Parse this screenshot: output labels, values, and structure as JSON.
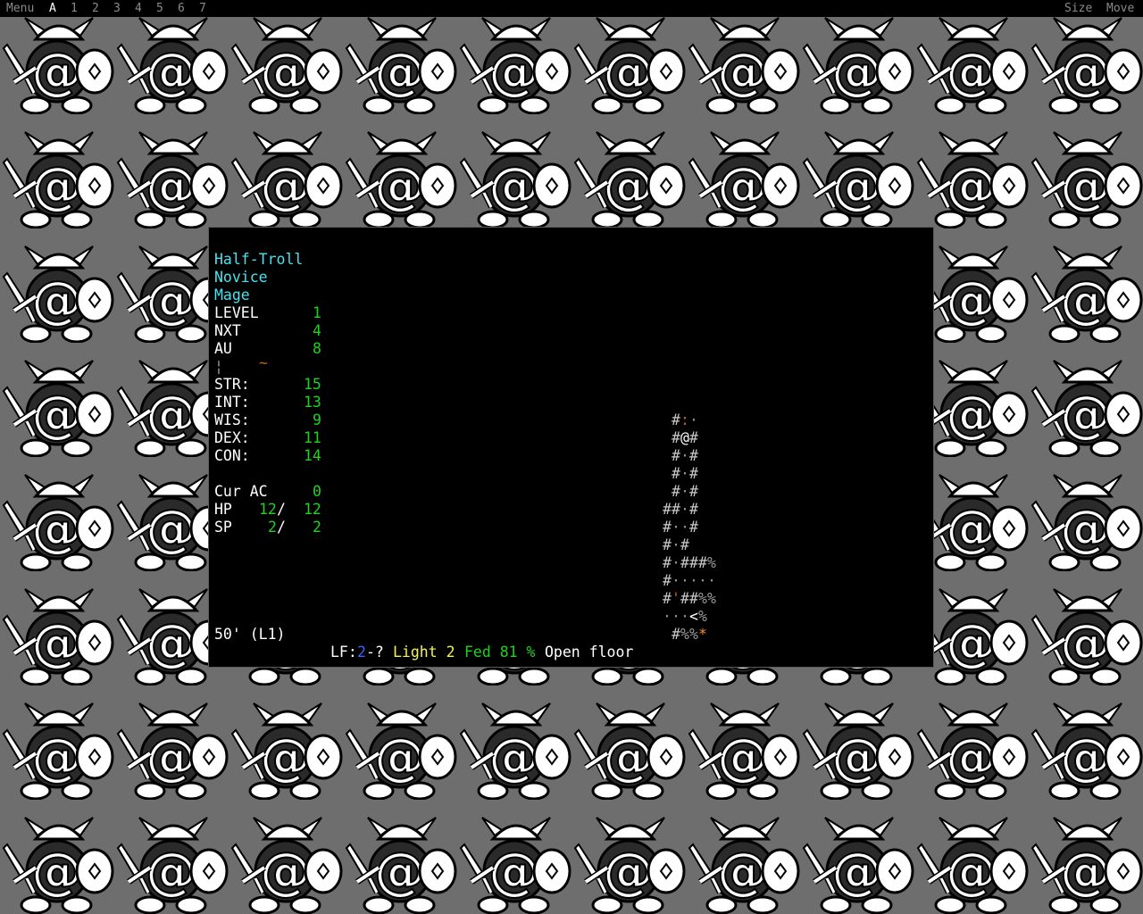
{
  "menubar": {
    "left": [
      "Menu",
      "A",
      "1",
      "2",
      "3",
      "4",
      "5",
      "6",
      "7"
    ],
    "active_index": 1,
    "right": [
      "Size",
      "Move"
    ]
  },
  "character": {
    "race": "Half-Troll",
    "title": "Novice",
    "class": "Mage",
    "level": {
      "label": "LEVEL",
      "value": "1"
    },
    "nxt": {
      "label": "NXT",
      "value": "4"
    },
    "au": {
      "label": "AU",
      "value": "8"
    },
    "equip": {
      "left": "¦",
      "right": "~"
    },
    "stats": [
      {
        "label": "STR:",
        "value": "15"
      },
      {
        "label": "INT:",
        "value": "13"
      },
      {
        "label": "WIS:",
        "value": "9"
      },
      {
        "label": "DEX:",
        "value": "11"
      },
      {
        "label": "CON:",
        "value": "14"
      }
    ],
    "ac": {
      "label": "Cur AC",
      "value": "0"
    },
    "hp": {
      "label": "HP",
      "cur": "12",
      "sep": "/",
      "max": "12"
    },
    "sp": {
      "label": "SP",
      "cur": "2",
      "sep": "/",
      "max": "2"
    },
    "depth": "50' (L1)"
  },
  "statusbar": {
    "lf_label": "LF:",
    "lf_value": "2",
    "lf_rest": "-?",
    "light": "Light 2",
    "fed": "Fed 81 %",
    "terrain": "Open floor"
  },
  "map": {
    "rows": [
      "        #:.",
      "        #@#",
      "        #.#",
      "        #.#",
      "        #.#",
      "       ##.#",
      "       #..#",
      "       #.#",
      "       #.###%",
      "       #.....",
      "       #'##%%",
      "       ...<%",
      "        #%%*"
    ]
  },
  "colors": {
    "background": "#6e6e6e",
    "terminal": "#000000",
    "cyan": "#4ae2ee",
    "green": "#1ed21e",
    "yellow": "#f2f25a",
    "blue": "#3c64ff",
    "orange": "#ff8a2a"
  }
}
